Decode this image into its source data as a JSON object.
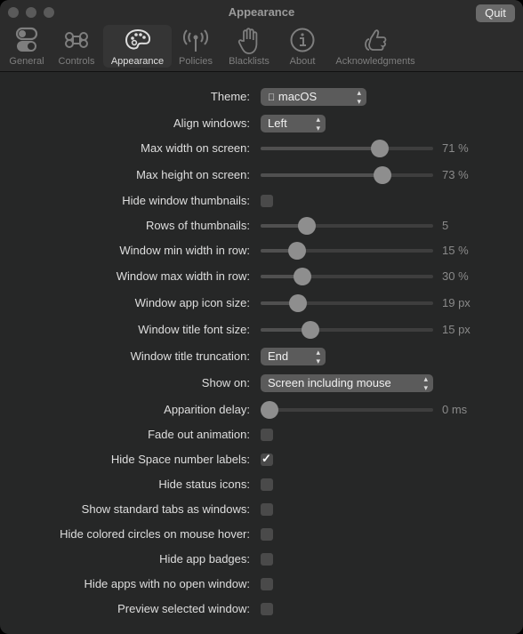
{
  "window": {
    "title": "Appearance",
    "quit_label": "Quit"
  },
  "tabs": [
    {
      "label": "General",
      "icon": "toggles-icon"
    },
    {
      "label": "Controls",
      "icon": "command-icon"
    },
    {
      "label": "Appearance",
      "icon": "palette-icon",
      "active": true
    },
    {
      "label": "Policies",
      "icon": "antenna-icon"
    },
    {
      "label": "Blacklists",
      "icon": "hand-icon"
    },
    {
      "label": "About",
      "icon": "info-icon"
    },
    {
      "label": "Acknowledgments",
      "icon": "thumbs-up-icon"
    }
  ],
  "settings": {
    "theme": {
      "label": "Theme:",
      "value": "macOS",
      "icon": "apple-icon"
    },
    "align_windows": {
      "label": "Align windows:",
      "value": "Left"
    },
    "max_width": {
      "label": "Max width on screen:",
      "value": "71 %",
      "fraction": 0.71
    },
    "max_height": {
      "label": "Max height on screen:",
      "value": "73 %",
      "fraction": 0.73
    },
    "hide_thumbnails": {
      "label": "Hide window thumbnails:",
      "checked": false
    },
    "rows": {
      "label": "Rows of thumbnails:",
      "value": "5",
      "fraction": 0.24
    },
    "min_width_row": {
      "label": "Window min width in row:",
      "value": "15 %",
      "fraction": 0.18
    },
    "max_width_row": {
      "label": "Window max width in row:",
      "value": "30 %",
      "fraction": 0.21
    },
    "app_icon_size": {
      "label": "Window app icon size:",
      "value": "19 px",
      "fraction": 0.185
    },
    "title_font_size": {
      "label": "Window title font size:",
      "value": "15 px",
      "fraction": 0.265
    },
    "title_truncation": {
      "label": "Window title truncation:",
      "value": "End"
    },
    "show_on": {
      "label": "Show on:",
      "value": "Screen including mouse"
    },
    "apparition_delay": {
      "label": "Apparition delay:",
      "value": "0 ms",
      "fraction": 0.0
    },
    "fade_out": {
      "label": "Fade out animation:",
      "checked": false
    },
    "hide_space_labels": {
      "label": "Hide Space number labels:",
      "checked": true
    },
    "hide_status_icons": {
      "label": "Hide status icons:",
      "checked": false
    },
    "show_tabs": {
      "label": "Show standard tabs as windows:",
      "checked": false
    },
    "hide_circles": {
      "label": "Hide colored circles on mouse hover:",
      "checked": false
    },
    "hide_badges": {
      "label": "Hide app badges:",
      "checked": false
    },
    "hide_no_window": {
      "label": "Hide apps with no open window:",
      "checked": false
    },
    "preview_selected": {
      "label": "Preview selected window:",
      "checked": false
    }
  }
}
